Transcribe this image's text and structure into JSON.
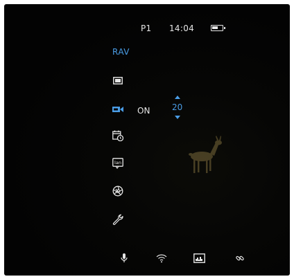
{
  "status_bar": {
    "profile": "P1",
    "time": "14:04",
    "battery_level": 0.6
  },
  "menu": {
    "title": "RAV",
    "items": [
      {
        "icon": "display-mode-icon",
        "selected": false
      },
      {
        "icon": "camera-record-icon",
        "selected": true
      },
      {
        "icon": "calendar-clock-icon",
        "selected": false
      },
      {
        "icon": "language-icon",
        "selected": false
      },
      {
        "icon": "shutter-icon",
        "selected": false
      },
      {
        "icon": "wrench-icon",
        "selected": false
      }
    ],
    "selected_value": {
      "state": "ON",
      "number": "20"
    }
  },
  "bottom_bar": {
    "icons": [
      "microphone-icon",
      "wifi-icon",
      "image-icon",
      "link-icon"
    ]
  },
  "colors": {
    "accent": "#4a9de6",
    "text": "#e6e6e6",
    "background": "#050505"
  }
}
